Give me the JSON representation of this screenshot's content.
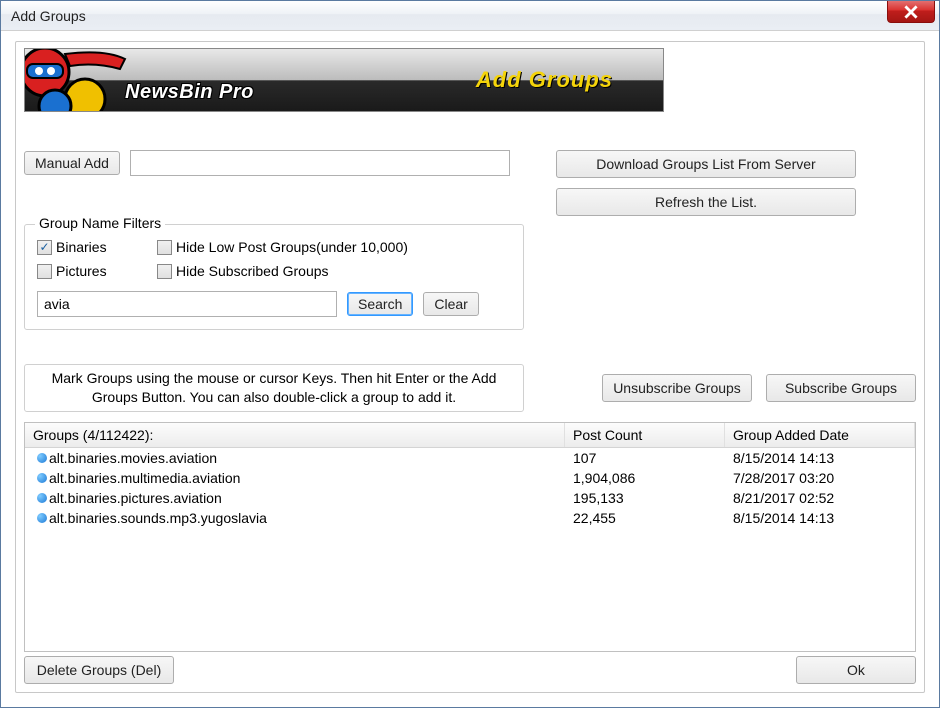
{
  "window": {
    "title": "Add Groups"
  },
  "banner": {
    "app_name": "NewsBin Pro",
    "title": "Add Groups"
  },
  "buttons": {
    "manual_add": "Manual Add",
    "download_list": "Download Groups List From Server",
    "refresh": "Refresh the List.",
    "search": "Search",
    "clear": "Clear",
    "unsubscribe": "Unsubscribe Groups",
    "subscribe": "Subscribe Groups",
    "delete": "Delete Groups (Del)",
    "ok": "Ok"
  },
  "inputs": {
    "manual_add_value": "",
    "search_value": "avia"
  },
  "filters": {
    "legend": "Group Name Filters",
    "binaries": {
      "label": "Binaries",
      "checked": true
    },
    "pictures": {
      "label": "Pictures",
      "checked": false
    },
    "hide_low": {
      "label": "Hide Low Post Groups(under 10,000)",
      "checked": false
    },
    "hide_sub": {
      "label": "Hide Subscribed Groups",
      "checked": false
    }
  },
  "hint": "Mark Groups using the mouse or cursor Keys. Then hit Enter or the Add Groups Button. You can also double-click a group to add it.",
  "list": {
    "header_name": "Groups (4/112422):",
    "header_post": "Post Count",
    "header_date": "Group Added Date",
    "rows": [
      {
        "name": "alt.binaries.movies.aviation",
        "post": "107",
        "date": "8/15/2014 14:13"
      },
      {
        "name": "alt.binaries.multimedia.aviation",
        "post": "1,904,086",
        "date": "7/28/2017 03:20"
      },
      {
        "name": "alt.binaries.pictures.aviation",
        "post": "195,133",
        "date": "8/21/2017 02:52"
      },
      {
        "name": "alt.binaries.sounds.mp3.yugoslavia",
        "post": "22,455",
        "date": "8/15/2014 14:13"
      }
    ]
  }
}
